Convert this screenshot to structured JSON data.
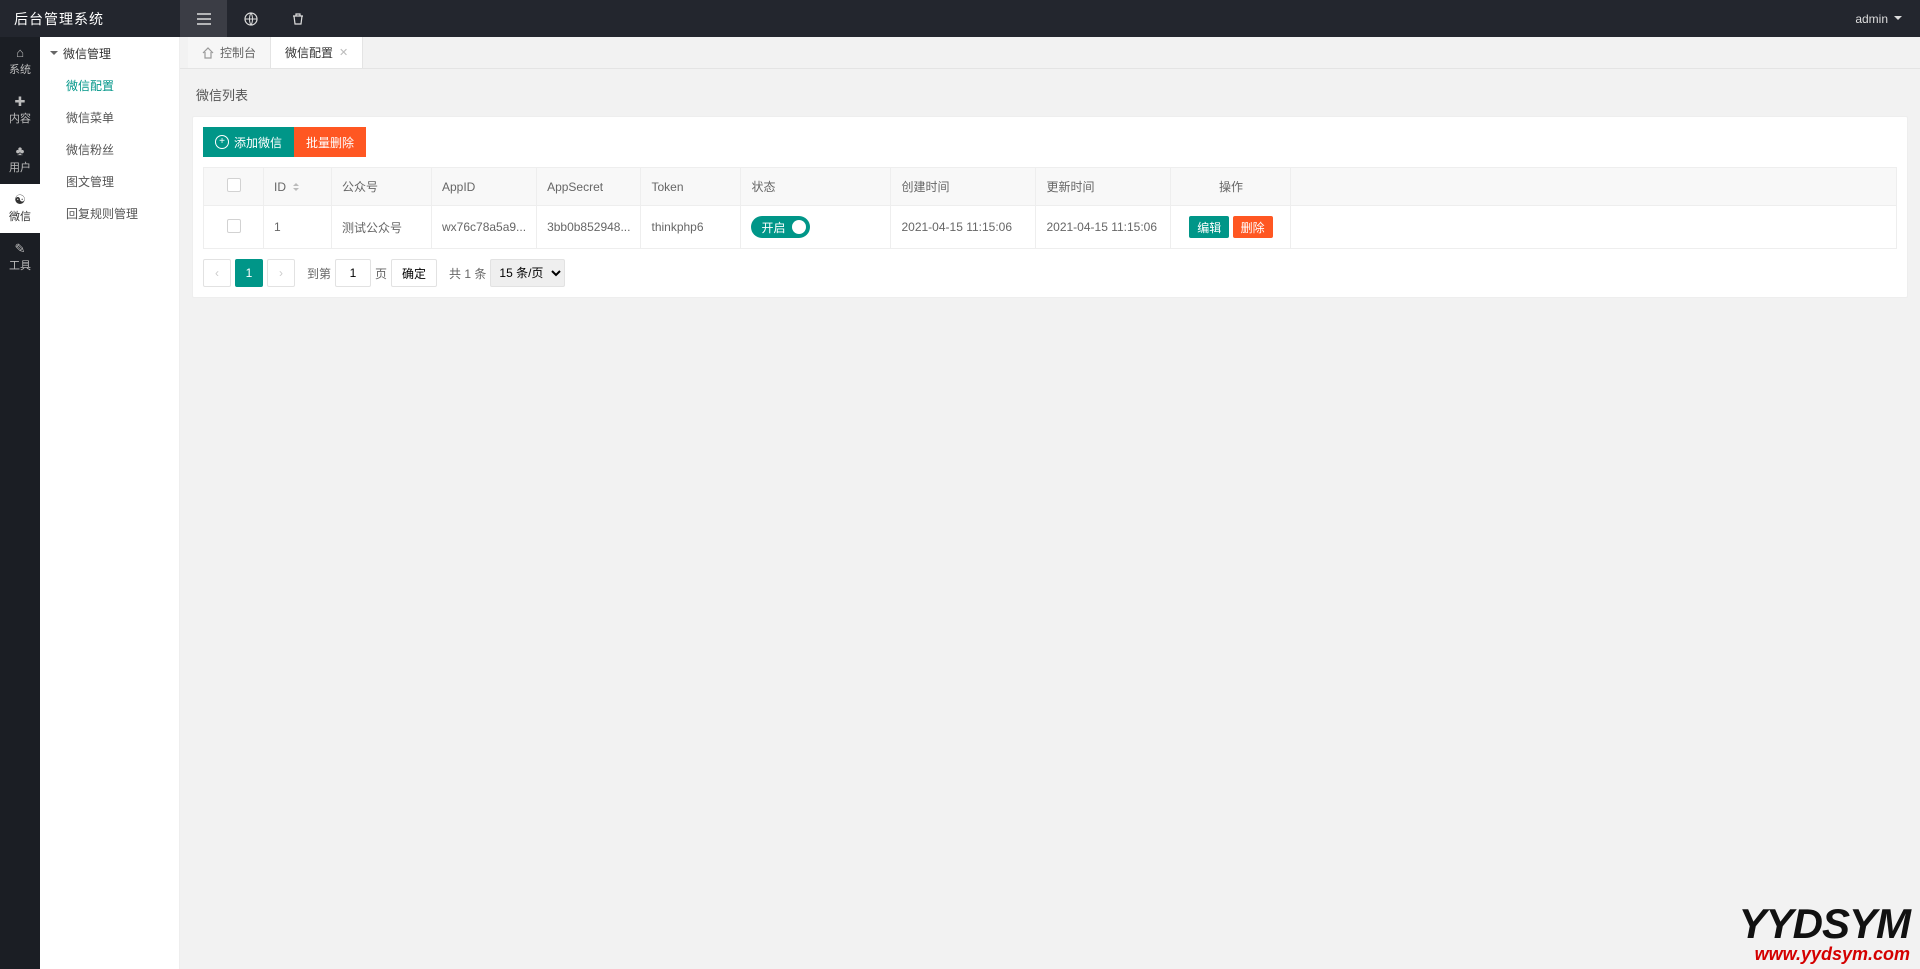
{
  "brand": "后台管理系统",
  "user": {
    "name": "admin"
  },
  "leftnav": {
    "items": [
      {
        "label": "系统"
      },
      {
        "label": "内容"
      },
      {
        "label": "用户"
      },
      {
        "label": "微信"
      },
      {
        "label": "工具"
      }
    ]
  },
  "sidebar": {
    "group": "微信管理",
    "items": [
      {
        "label": "微信配置"
      },
      {
        "label": "微信菜单"
      },
      {
        "label": "微信粉丝"
      },
      {
        "label": "图文管理"
      },
      {
        "label": "回复规则管理"
      }
    ]
  },
  "tabs": {
    "home": "控制台",
    "active": "微信配置"
  },
  "page": {
    "title": "微信列表"
  },
  "toolbar": {
    "add": "添加微信",
    "batch_delete": "批量删除"
  },
  "table": {
    "headers": {
      "id": "ID",
      "account": "公众号",
      "appid": "AppID",
      "appsecret": "AppSecret",
      "token": "Token",
      "status": "状态",
      "created": "创建时间",
      "updated": "更新时间",
      "ops": "操作"
    },
    "rows": [
      {
        "id": "1",
        "account": "测试公众号",
        "appid": "wx76c78a5a9...",
        "appsecret": "3bb0b852948...",
        "token": "thinkphp6",
        "status_label": "开启",
        "created": "2021-04-15 11:15:06",
        "updated": "2021-04-15 11:15:06"
      }
    ],
    "ops": {
      "edit": "编辑",
      "delete": "删除"
    }
  },
  "pager": {
    "current": "1",
    "goto_prefix": "到第",
    "goto_value": "1",
    "goto_suffix": "页",
    "confirm": "确定",
    "total": "共 1 条",
    "page_size": "15 条/页"
  },
  "watermark": {
    "big": "YYDSYM",
    "url": "www.yydsym.com"
  }
}
